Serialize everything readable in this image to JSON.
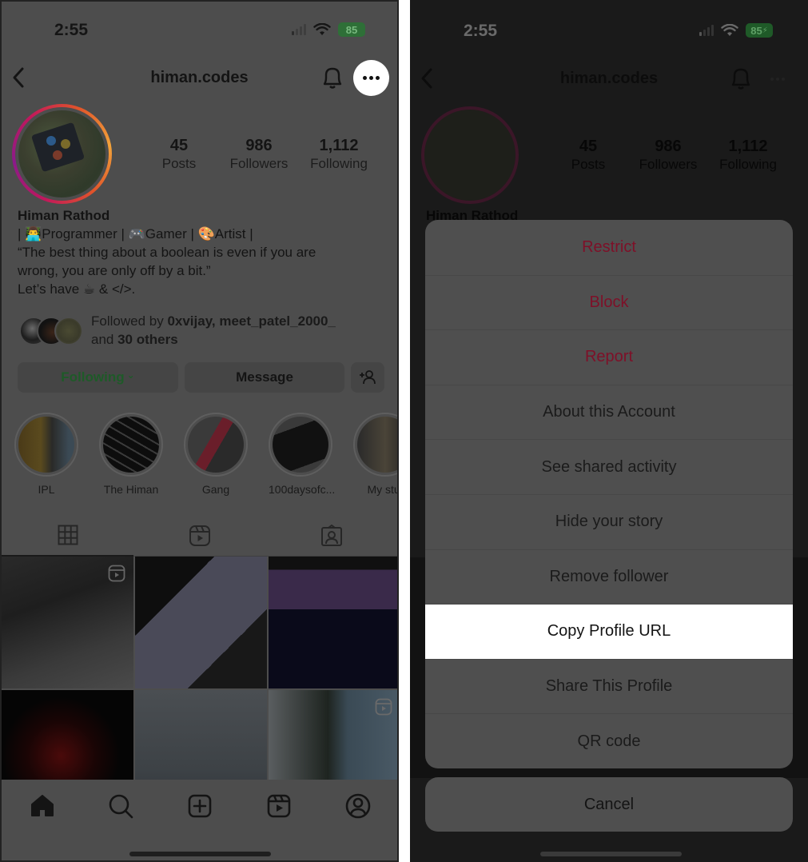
{
  "status_bar": {
    "time": "2:55",
    "battery": "85",
    "battery_charging_glyph": "⚡"
  },
  "header": {
    "username": "himan.codes",
    "icons": [
      "chevron-left-icon",
      "bell-icon",
      "more-horizontal-icon"
    ]
  },
  "profile": {
    "stats": [
      {
        "value": "45",
        "label": "Posts"
      },
      {
        "value": "986",
        "label": "Followers"
      },
      {
        "value": "1,112",
        "label": "Following"
      }
    ],
    "name": "Himan Rathod",
    "bio_lines": [
      "| 👨‍💻Programmer | 🎮Gamer | 🎨Artist |",
      "“The best thing about a boolean is even if you are",
      "wrong, you are only off by a bit.”",
      "Let’s have ☕ & </>."
    ],
    "followed_by": {
      "prefix": "Followed by ",
      "names": "0xvijay, meet_patel_2000_",
      "and": "and ",
      "others": "30 others"
    },
    "buttons": {
      "following": "Following",
      "following_chevron": "⌄",
      "message": "Message"
    },
    "accent_following": "#1e5a28"
  },
  "highlights": [
    {
      "label": "IPL"
    },
    {
      "label": "The Himan"
    },
    {
      "label": "Gang"
    },
    {
      "label": "100daysofc..."
    },
    {
      "label": "My stuf"
    }
  ],
  "profile_tabs": [
    "grid-icon",
    "reels-icon",
    "tagged-icon"
  ],
  "bottom_tabs": [
    "home-icon",
    "search-icon",
    "create-icon",
    "reels-icon",
    "profile-icon"
  ],
  "action_sheet": {
    "items": [
      {
        "label": "Restrict",
        "style": "danger"
      },
      {
        "label": "Block",
        "style": "danger"
      },
      {
        "label": "Report",
        "style": "danger"
      },
      {
        "label": "About this Account",
        "style": "normal"
      },
      {
        "label": "See shared activity",
        "style": "normal"
      },
      {
        "label": "Hide your story",
        "style": "normal"
      },
      {
        "label": "Remove follower",
        "style": "normal"
      },
      {
        "label": "Copy Profile URL",
        "style": "selected"
      },
      {
        "label": "Share This Profile",
        "style": "normal"
      },
      {
        "label": "QR code",
        "style": "normal"
      }
    ],
    "cancel": "Cancel",
    "danger_color": "#7e1028"
  }
}
